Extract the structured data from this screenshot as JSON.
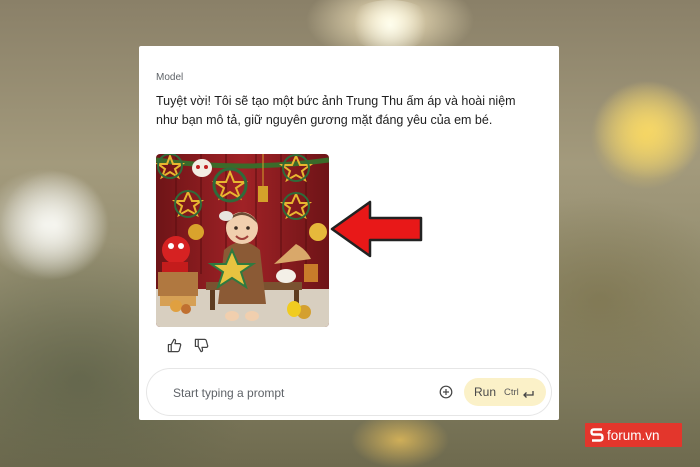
{
  "panel": {
    "role_label": "Model",
    "message": "Tuyệt vời! Tôi sẽ tạo một bức ảnh Trung Thu ấm áp và hoài niệm như bạn mô tả, giữ nguyên gương mặt đáng yêu của em bé."
  },
  "generated_image": {
    "subject": "baby-mid-autumn-photo",
    "colors": {
      "curtain": "#8c1d20",
      "floor": "#d8cfc0",
      "bench": "#7a5230",
      "outfit": "#8b5a35"
    }
  },
  "reactions": {
    "like_icon": "thumbs-up-icon",
    "dislike_icon": "thumbs-down-icon"
  },
  "prompt_bar": {
    "placeholder": "Start typing a prompt",
    "add_icon": "plus-circle-icon",
    "run_label": "Run",
    "run_shortcut": "Ctrl",
    "enter_icon": "enter-key-icon",
    "run_color": "#fbf1c8"
  },
  "annotation": {
    "arrow_color": "#e81818"
  },
  "watermark": {
    "text": "forum.vn",
    "color": "#e3362c"
  }
}
